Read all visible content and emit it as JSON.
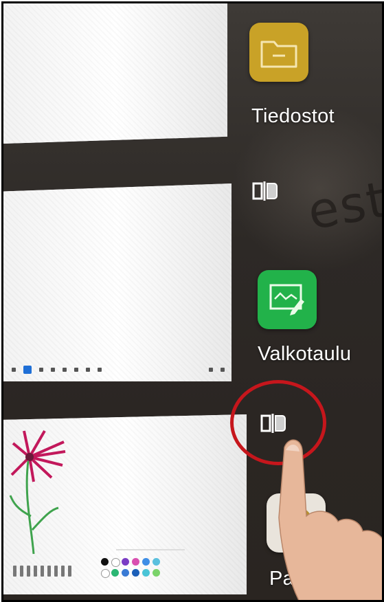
{
  "apps": [
    {
      "name": "files",
      "label": "Tiedostot",
      "icon": "folder-icon",
      "color": "#c9a227"
    },
    {
      "name": "whiteboard",
      "label": "Valkotaulu",
      "icon": "whiteboard-icon",
      "color": "#22b24a"
    },
    {
      "name": "paint",
      "label": "Pa",
      "icon": "paint-palette-icon",
      "color": "#e9e4dc"
    }
  ],
  "split_screen": {
    "icon": "split-screen-icon"
  },
  "background_text": "esti",
  "palette_colors": [
    "#111111",
    "#ffffff",
    "#7a3cc4",
    "#d94fb0",
    "#3e8ee6",
    "#5bc0de",
    "#ffffff",
    "#2bb673",
    "#3a7bd5",
    "#1c5fb8",
    "#4ac4d6",
    "#7bd36a"
  ],
  "highlight_color": "#c6161c"
}
